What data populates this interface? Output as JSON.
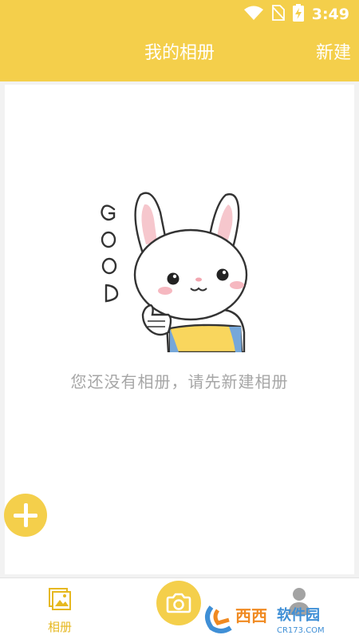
{
  "status_bar": {
    "time": "3:49",
    "icons": [
      "wifi-icon",
      "no-sim-icon",
      "battery-charging-icon"
    ]
  },
  "header": {
    "title": "我的相册",
    "action_label": "新建"
  },
  "empty_state": {
    "mascot_text": "GOOD",
    "message": "您还没有相册，请先新建相册"
  },
  "fab": {
    "icon": "plus-icon"
  },
  "tab_bar": {
    "album": {
      "label": "相册",
      "icon": "album-icon"
    },
    "camera": {
      "icon": "camera-icon"
    },
    "profile": {
      "icon": "person-icon"
    }
  },
  "watermark": {
    "brand": "西西",
    "site_name": "软件园",
    "domain": "CR173.COM"
  },
  "colors": {
    "accent": "#f4cf4b",
    "tab_active": "#e6b820",
    "empty_text": "#a6a6a6"
  }
}
